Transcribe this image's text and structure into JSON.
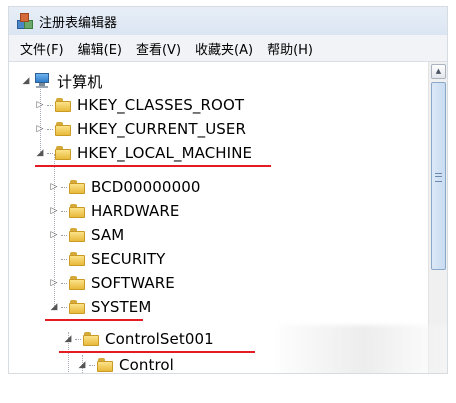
{
  "window": {
    "title": "注册表编辑器"
  },
  "menu": [
    "文件(F)",
    "编辑(E)",
    "查看(V)",
    "收藏夹(A)",
    "帮助(H)"
  ],
  "tree": {
    "root": "计算机",
    "nodes": [
      {
        "label": "HKEY_CLASSES_ROOT",
        "expander": "▷"
      },
      {
        "label": "HKEY_CURRENT_USER",
        "expander": "▷"
      },
      {
        "label": "HKEY_LOCAL_MACHINE",
        "expander": "◢",
        "highlighted": true
      },
      {
        "label": "BCD00000000",
        "expander": "▷"
      },
      {
        "label": "HARDWARE",
        "expander": "▷"
      },
      {
        "label": "SAM",
        "expander": "▷"
      },
      {
        "label": "SECURITY",
        "expander": ""
      },
      {
        "label": "SOFTWARE",
        "expander": "▷"
      },
      {
        "label": "SYSTEM",
        "expander": "◢",
        "highlighted": true
      },
      {
        "label": "ControlSet001",
        "expander": "◢",
        "highlighted": true
      },
      {
        "label": "Control",
        "expander": "◢"
      }
    ]
  },
  "highlight_color": "#e51b24",
  "scrollbar": {
    "up_arrow": "▲"
  }
}
